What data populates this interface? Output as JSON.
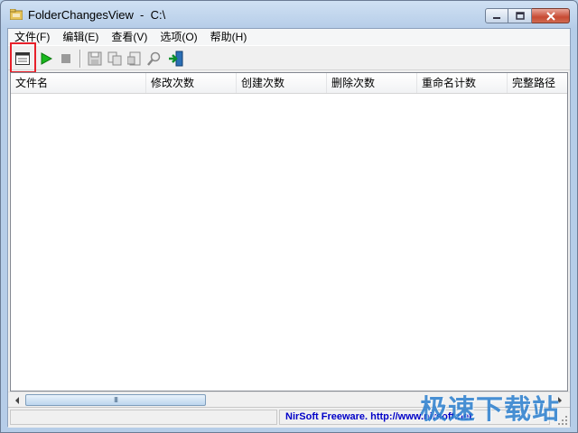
{
  "window": {
    "title": "FolderChangesView  -  C:\\"
  },
  "menu": [
    {
      "label": "文件(F)"
    },
    {
      "label": "编辑(E)"
    },
    {
      "label": "查看(V)"
    },
    {
      "label": "选项(O)"
    },
    {
      "label": "帮助(H)"
    }
  ],
  "toolbar": {
    "icons": [
      "window-icon",
      "play-icon",
      "stop-icon",
      "save-icon",
      "copy-icon",
      "properties-icon",
      "find-icon",
      "exit-icon"
    ],
    "highlight_color": "#e8202a"
  },
  "columns": [
    {
      "label": "文件名"
    },
    {
      "label": "修改次数"
    },
    {
      "label": "创建次数"
    },
    {
      "label": "删除次数"
    },
    {
      "label": "重命名计数"
    },
    {
      "label": "完整路径"
    }
  ],
  "scrollbar": {
    "grip": "III"
  },
  "status": {
    "link_text": "NirSoft Freeware.  http://www.nirsoft.net"
  },
  "watermark": {
    "text": "极速下载站"
  },
  "colors": {
    "link": "#0000c8",
    "watermark": "#2a7fcf"
  }
}
